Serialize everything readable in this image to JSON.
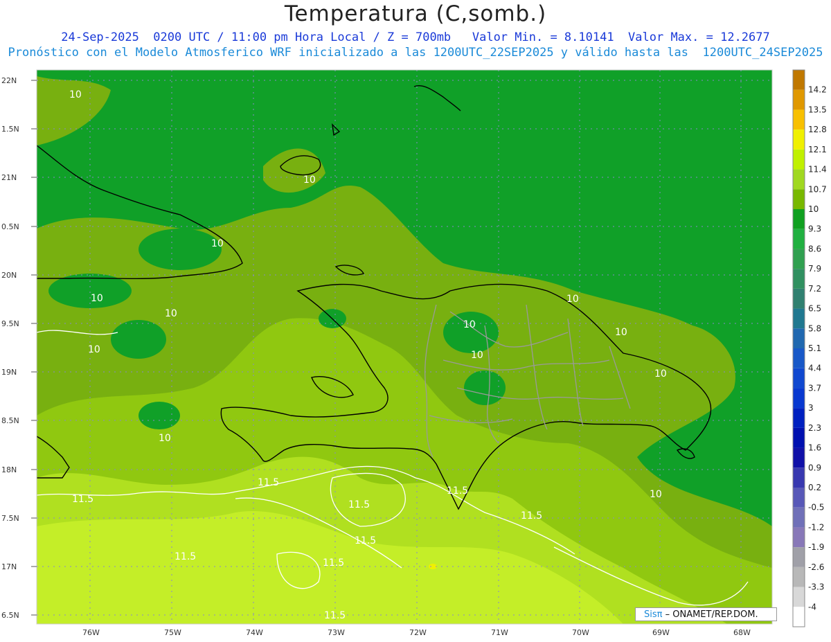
{
  "header": {
    "title": "Temperatura (C,somb.)",
    "line1": "24-Sep-2025  0200 UTC / 11:00 pm Hora Local / Z = 700mb   Valor Min. = 8.10141  Valor Max. = 12.2677",
    "line2": "Pronóstico con el Modelo Atmosferico WRF inicializado a las 1200UTC_22SEP2025 y válido hasta las  1200UTC_24SEP2025"
  },
  "axes": {
    "lat_labels": [
      "22N",
      "1.5N",
      "21N",
      "0.5N",
      "20N",
      "9.5N",
      "19N",
      "8.5N",
      "18N",
      "7.5N",
      "17N",
      "6.5N"
    ],
    "lon_labels": [
      "76W",
      "75W",
      "74W",
      "73W",
      "72W",
      "71W",
      "70W",
      "69W",
      "68W"
    ]
  },
  "legend": {
    "labels": [
      "14.2",
      "13.5",
      "12.8",
      "12.1",
      "11.4",
      "10.7",
      "10",
      "9.3",
      "8.6",
      "7.9",
      "7.2",
      "6.5",
      "5.8",
      "5.1",
      "4.4",
      "3.7",
      "3",
      "2.3",
      "1.6",
      "0.9",
      "0.2",
      "-0.5",
      "-1.2",
      "-1.9",
      "-2.6",
      "-3.3",
      "-4"
    ],
    "colors": [
      "#c07800",
      "#e09800",
      "#f8c000",
      "#f0f000",
      "#c0f000",
      "#a0d820",
      "#78b800",
      "#10a020",
      "#20b040",
      "#30a050",
      "#309060",
      "#308070",
      "#207890",
      "#2068b0",
      "#1858c8",
      "#1048d0",
      "#0838d0",
      "#0020c0",
      "#0010b0",
      "#1010a8",
      "#3838b0",
      "#5858b8",
      "#7070b8",
      "#8878b8",
      "#a0a0a8",
      "#b8b8b8",
      "#d8d8d8",
      "#ffffff"
    ]
  },
  "contours": {
    "labels_10": "10",
    "labels_11_5": "11.5"
  },
  "credit": {
    "logo": "Sisπ",
    "text": "– ONAMET/REP.DOM."
  }
}
